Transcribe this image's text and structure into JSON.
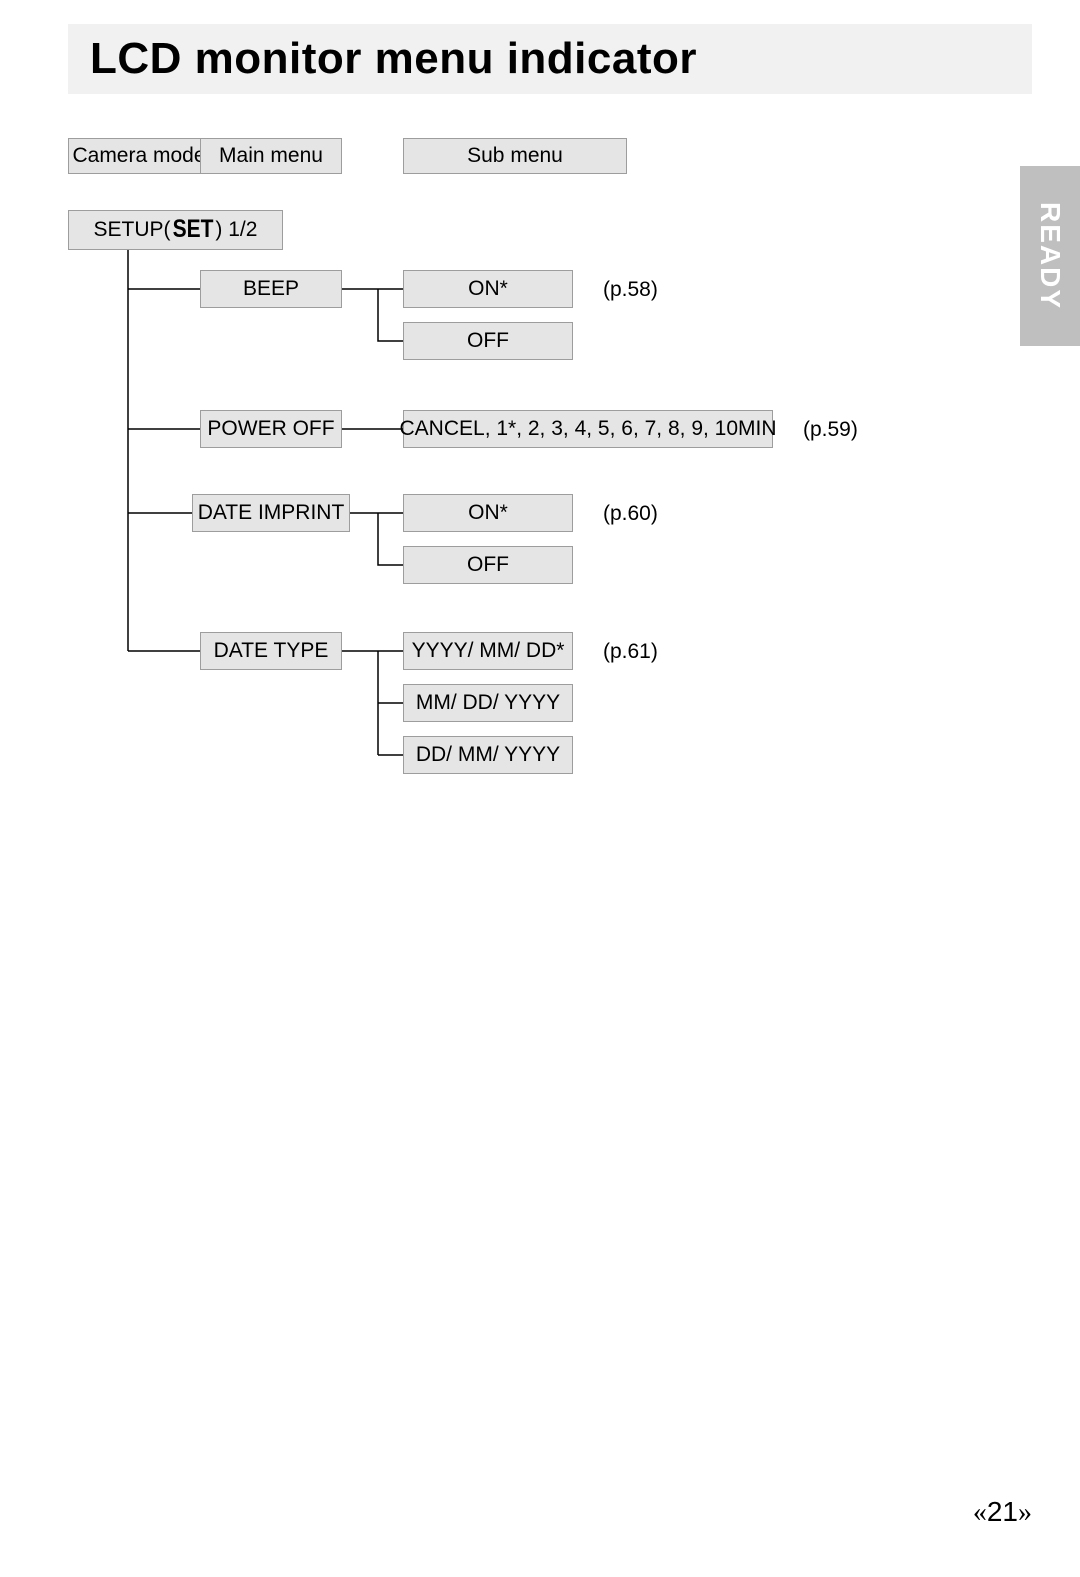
{
  "title": "LCD monitor menu indicator",
  "sideTab": "READY",
  "headers": {
    "camera_mode": "Camera mode",
    "main_menu": "Main menu",
    "sub_menu": "Sub menu"
  },
  "root": {
    "prefix": "SETUP(",
    "icon_text": "SET",
    "suffix": ") 1/2"
  },
  "items": {
    "beep": {
      "label": "BEEP",
      "opts": [
        "ON*",
        "OFF"
      ],
      "page": "(p.58)"
    },
    "power_off": {
      "label": "POWER OFF",
      "opts": [
        "CANCEL, 1*, 2, 3, 4, 5, 6, 7, 8, 9, 10MIN"
      ],
      "page": "(p.59)"
    },
    "date_imprint": {
      "label": "DATE IMPRINT",
      "opts": [
        "ON*",
        "OFF"
      ],
      "page": "(p.60)"
    },
    "date_type": {
      "label": "DATE TYPE",
      "opts": [
        "YYYY/ MM/ DD*",
        "MM/ DD/ YYYY",
        "DD/ MM/ YYYY"
      ],
      "page": "(p.61)"
    }
  },
  "pageNumber": "21"
}
